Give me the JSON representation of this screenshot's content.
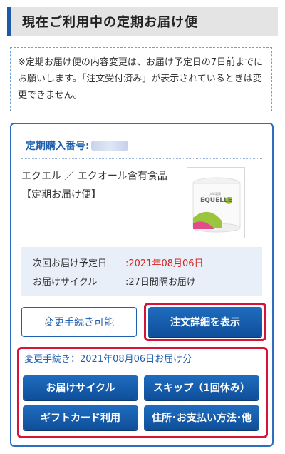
{
  "header": {
    "title": "現在ご利用中の定期お届け便"
  },
  "notice": {
    "text": "※定期お届け便の内容変更は、お届け予定日の7日前までにお願いします。「注文受付済み」が表示されているときは変更できません。"
  },
  "card": {
    "order_number_label": "定期購入番号:",
    "product": {
      "line1": "エクエル ／ エクオール含有食品",
      "line2": "【定期お届け便】"
    },
    "product_image_text": {
      "brand_small": "大塚製薬",
      "brand": "EQUELLE"
    },
    "schedule": {
      "next_label": "次回お届け予定日",
      "next_value": ":2021年08月06日",
      "cycle_label": "お届けサイクル",
      "cycle_value": ":27日間隔お届け"
    },
    "change_status_button": "変更手続き可能",
    "order_detail_button": "注文詳細を表示",
    "procedures": {
      "title": "変更手続き：2021年08月06日お届け分",
      "buttons": [
        "お届けサイクル",
        "スキップ（1回休み）",
        "ギフトカード利用",
        "住所･お支払い方法･他"
      ]
    }
  },
  "colors": {
    "accent": "#1e5fae",
    "highlight": "#d6143a",
    "date_red": "#d0261f"
  }
}
